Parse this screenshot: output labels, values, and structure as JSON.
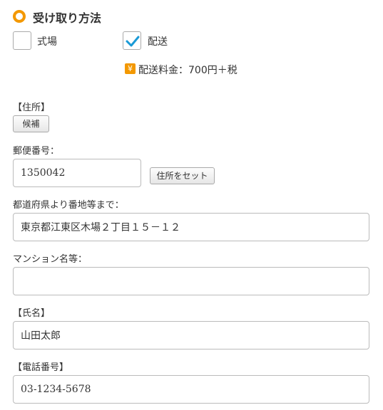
{
  "section": {
    "title": "受け取り方法"
  },
  "receive_options": {
    "venue": {
      "label": "式場",
      "checked": false
    },
    "delivery": {
      "label": "配送",
      "checked": true
    }
  },
  "fee": {
    "icon": "yen-icon",
    "icon_glyph": "¥",
    "text": "配送料金：700円＋税"
  },
  "address": {
    "heading": "【住所】",
    "candidate_button": "候補",
    "postal_label": "郵便番号：",
    "postal_value": "1350042",
    "set_address_button": "住所をセット",
    "street_label": "都道府県より番地等まで：",
    "street_value": "東京都江東区木場２丁目１５－１２",
    "building_label": "マンション名等：",
    "building_value": ""
  },
  "name": {
    "heading": "【氏名】",
    "value": "山田太郎"
  },
  "phone": {
    "heading": "【電話番号】",
    "value": "03-1234-5678"
  },
  "colors": {
    "accent": "#f39800",
    "check": "#1a9ad6"
  }
}
